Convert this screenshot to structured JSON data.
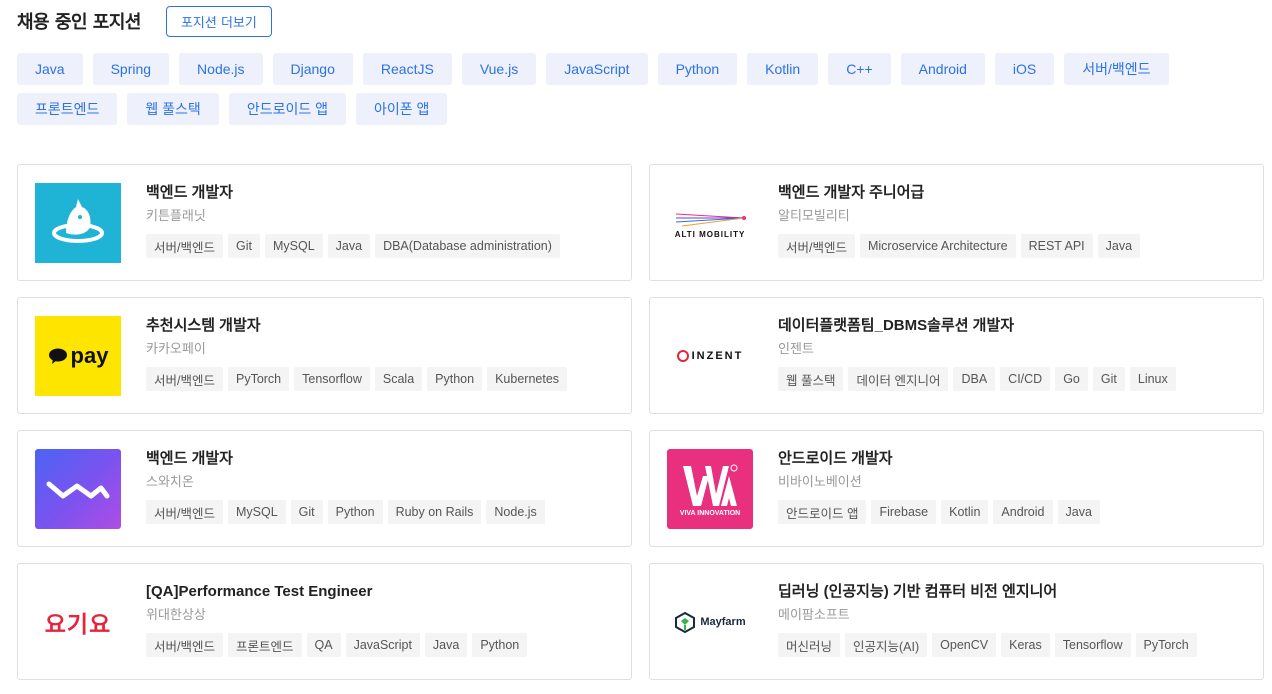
{
  "header": {
    "title": "채용 중인 포지션",
    "more_label": "포지션 더보기"
  },
  "filters": [
    "Java",
    "Spring",
    "Node.js",
    "Django",
    "ReactJS",
    "Vue.js",
    "JavaScript",
    "Python",
    "Kotlin",
    "C++",
    "Android",
    "iOS",
    "서버/백엔드",
    "프론트엔드",
    "웹 풀스택",
    "안드로이드 앱",
    "아이폰 앱"
  ],
  "positions": [
    {
      "title": "백엔드 개발자",
      "company": "키튼플래닛",
      "logo": "kitten-planet-logo",
      "tags": [
        "서버/백엔드",
        "Git",
        "MySQL",
        "Java",
        "DBA(Database administration)"
      ]
    },
    {
      "title": "백엔드 개발자 주니어급",
      "company": "알티모빌리티",
      "logo": "alti-mobility-logo",
      "logo_text": "ALTI MOBILITY",
      "tags": [
        "서버/백엔드",
        "Microservice Architecture",
        "REST API",
        "Java"
      ]
    },
    {
      "title": "추천시스템 개발자",
      "company": "카카오페이",
      "logo": "kakaopay-logo",
      "logo_text": "pay",
      "tags": [
        "서버/백엔드",
        "PyTorch",
        "Tensorflow",
        "Scala",
        "Python",
        "Kubernetes"
      ]
    },
    {
      "title": "데이터플랫폼팀_DBMS솔루션 개발자",
      "company": "인젠트",
      "logo": "inzent-logo",
      "logo_text": "INZENT",
      "tags": [
        "웹 풀스택",
        "데이터 엔지니어",
        "DBA",
        "CI/CD",
        "Go",
        "Git",
        "Linux"
      ]
    },
    {
      "title": "백엔드 개발자",
      "company": "스와치온",
      "logo": "swatchon-logo",
      "tags": [
        "서버/백엔드",
        "MySQL",
        "Git",
        "Python",
        "Ruby on Rails",
        "Node.js"
      ]
    },
    {
      "title": "안드로이드 개발자",
      "company": "비바이노베이션",
      "logo": "viva-innovation-logo",
      "logo_text": "VIVA INNOVATION",
      "tags": [
        "안드로이드 앱",
        "Firebase",
        "Kotlin",
        "Android",
        "Java"
      ]
    },
    {
      "title": "[QA]Performance Test Engineer",
      "company": "위대한상상",
      "logo": "yogiyo-logo",
      "logo_text": "요기요",
      "tags": [
        "서버/백엔드",
        "프론트엔드",
        "QA",
        "JavaScript",
        "Java",
        "Python"
      ]
    },
    {
      "title": "딥러닝 (인공지능) 기반 컴퓨터 비전 엔지니어",
      "company": "메이팜소프트",
      "logo": "mayfarm-logo",
      "logo_text": "Mayfarm",
      "tags": [
        "머신러닝",
        "인공지능(AI)",
        "OpenCV",
        "Keras",
        "Tensorflow",
        "PyTorch"
      ]
    }
  ],
  "colors": {
    "accent": "#2b73e5",
    "chip_bg": "#eef0fb",
    "tag_bg": "#f4f4f4",
    "kitten": "#1fb3d6",
    "kakao": "#fee500",
    "viva": "#e8307f",
    "yogiyo": "#e8233c"
  }
}
